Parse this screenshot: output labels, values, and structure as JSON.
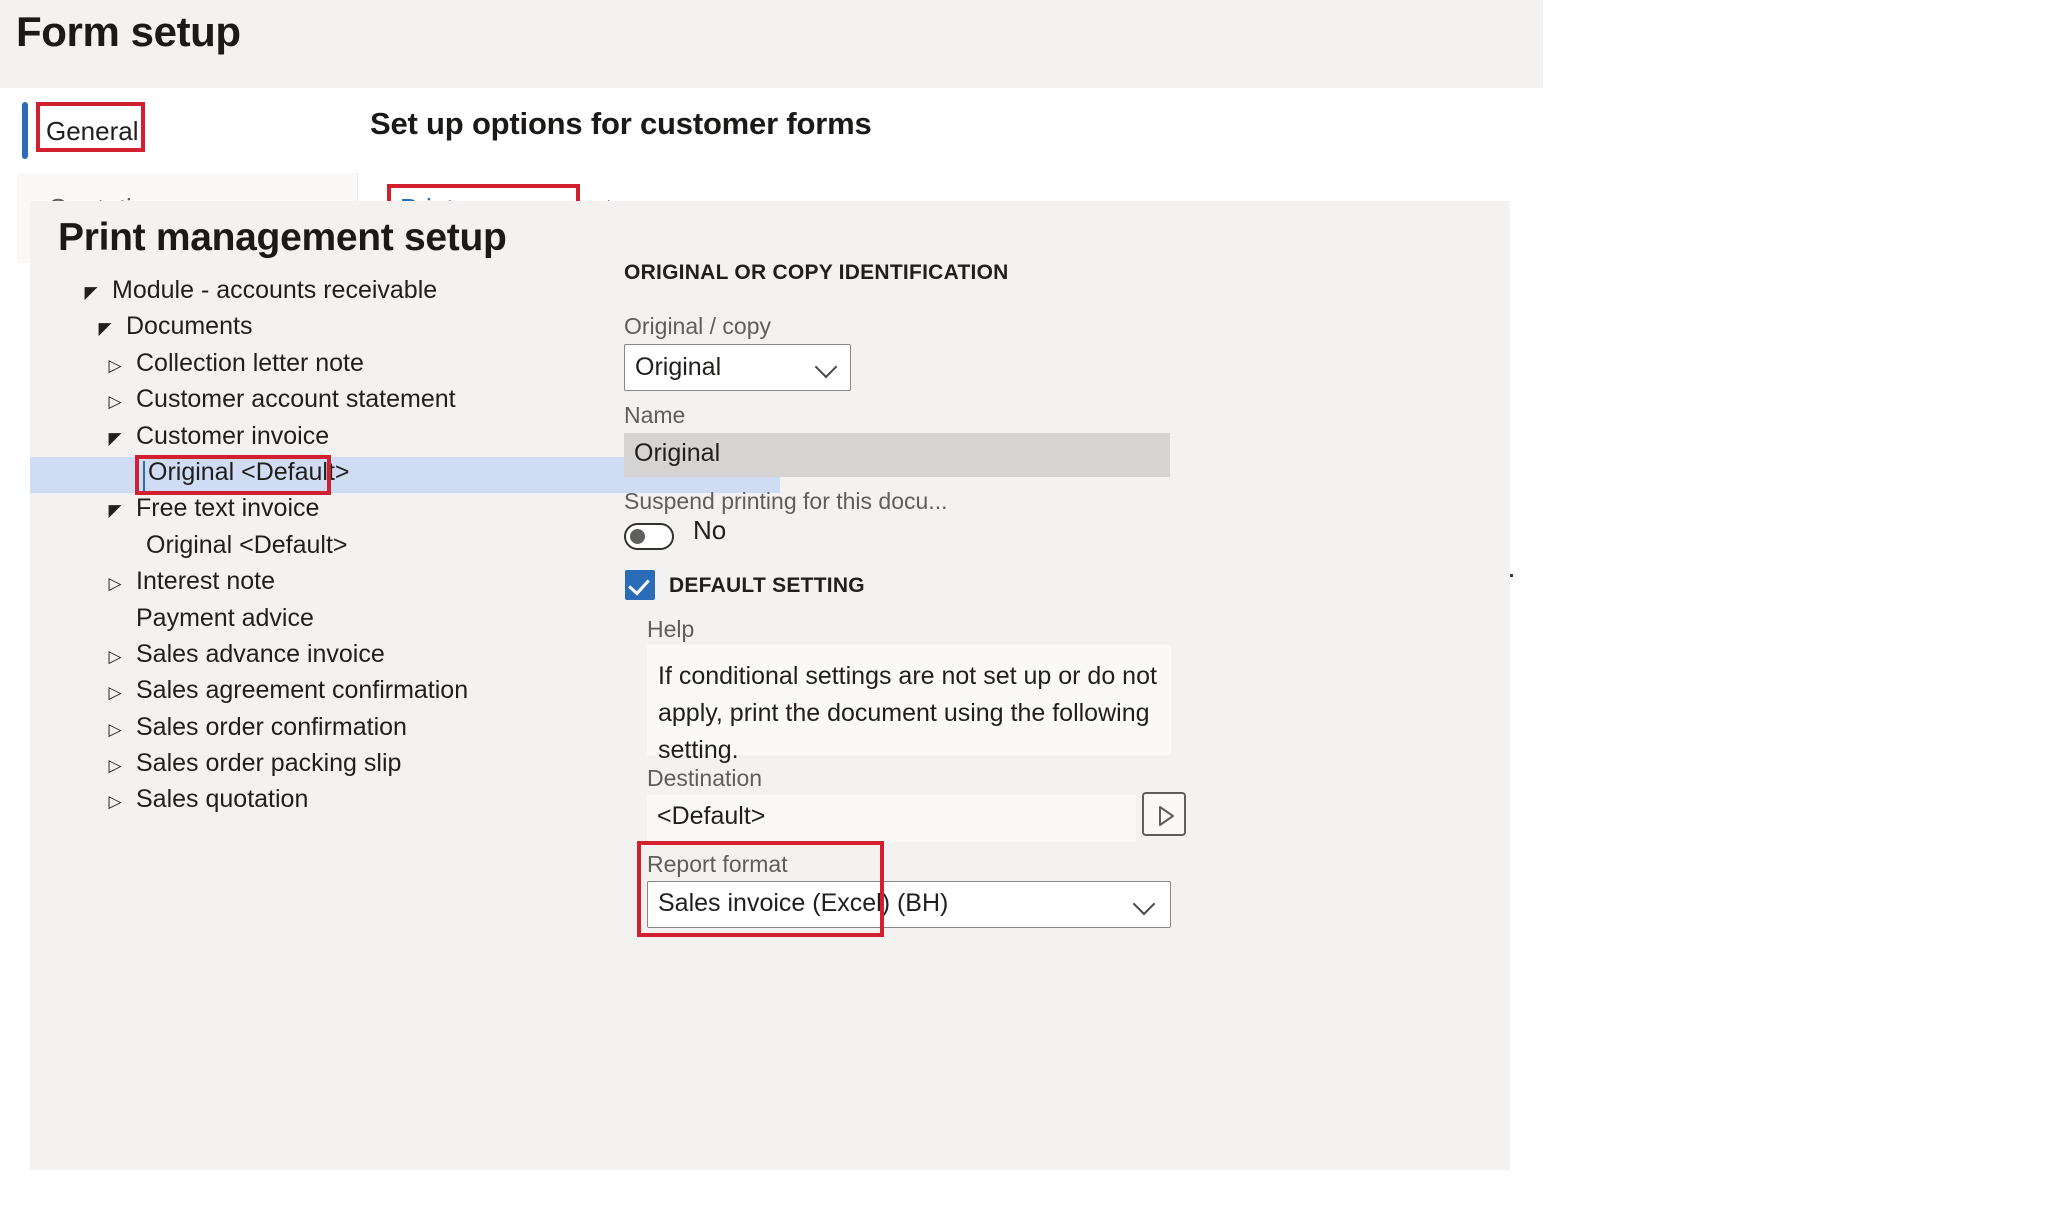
{
  "header": {
    "title": "Form setup"
  },
  "nav": {
    "general_label": "General",
    "setup_heading": "Set up options for customer forms"
  },
  "tabs": [
    {
      "label": "Quotation",
      "selected": false
    },
    {
      "label": "Print management",
      "selected": true
    }
  ],
  "content": {
    "section_title": "Print management setup"
  },
  "tree": {
    "items": [
      {
        "label": "Module - accounts receivable",
        "level": 0,
        "twisty": "expanded"
      },
      {
        "label": "Documents",
        "level": 1,
        "twisty": "expanded"
      },
      {
        "label": "Collection letter note",
        "level": 2,
        "twisty": "collapsed"
      },
      {
        "label": "Customer account statement",
        "level": 2,
        "twisty": "collapsed"
      },
      {
        "label": "Customer invoice",
        "level": 2,
        "twisty": "expanded"
      },
      {
        "label": "Original <Default>",
        "level": 3,
        "twisty": "none",
        "selected": true
      },
      {
        "label": "Free text invoice",
        "level": 2,
        "twisty": "expanded"
      },
      {
        "label": "Original <Default>",
        "level": 3,
        "twisty": "none"
      },
      {
        "label": "Interest note",
        "level": 2,
        "twisty": "collapsed"
      },
      {
        "label": "Payment advice",
        "level": 2,
        "twisty": "none"
      },
      {
        "label": "Sales advance invoice",
        "level": 2,
        "twisty": "collapsed"
      },
      {
        "label": "Sales agreement confirmation",
        "level": 2,
        "twisty": "collapsed"
      },
      {
        "label": "Sales order confirmation",
        "level": 2,
        "twisty": "collapsed"
      },
      {
        "label": "Sales order packing slip",
        "level": 2,
        "twisty": "collapsed"
      },
      {
        "label": "Sales quotation",
        "level": 2,
        "twisty": "collapsed"
      }
    ]
  },
  "detail": {
    "section_head": "ORIGINAL OR COPY IDENTIFICATION",
    "original_copy_label": "Original / copy",
    "original_copy_value": "Original",
    "name_label": "Name",
    "name_value": "Original",
    "suspend_label": "Suspend printing for this docu...",
    "suspend_value": "No",
    "default_setting_label": "DEFAULT SETTING",
    "help_label": "Help",
    "help_text": "If conditional settings are not set up or do not apply, print the document using the following setting.",
    "destination_label": "Destination",
    "destination_value": "<Default>",
    "report_format_label": "Report format",
    "report_format_value": "Sales invoice (Excel) (BH)"
  },
  "colors": {
    "accent_blue": "#2b6cb8",
    "annotation_red": "#d32030",
    "selection_blue": "#cfdcf3",
    "surface": "#f3f2f1"
  }
}
